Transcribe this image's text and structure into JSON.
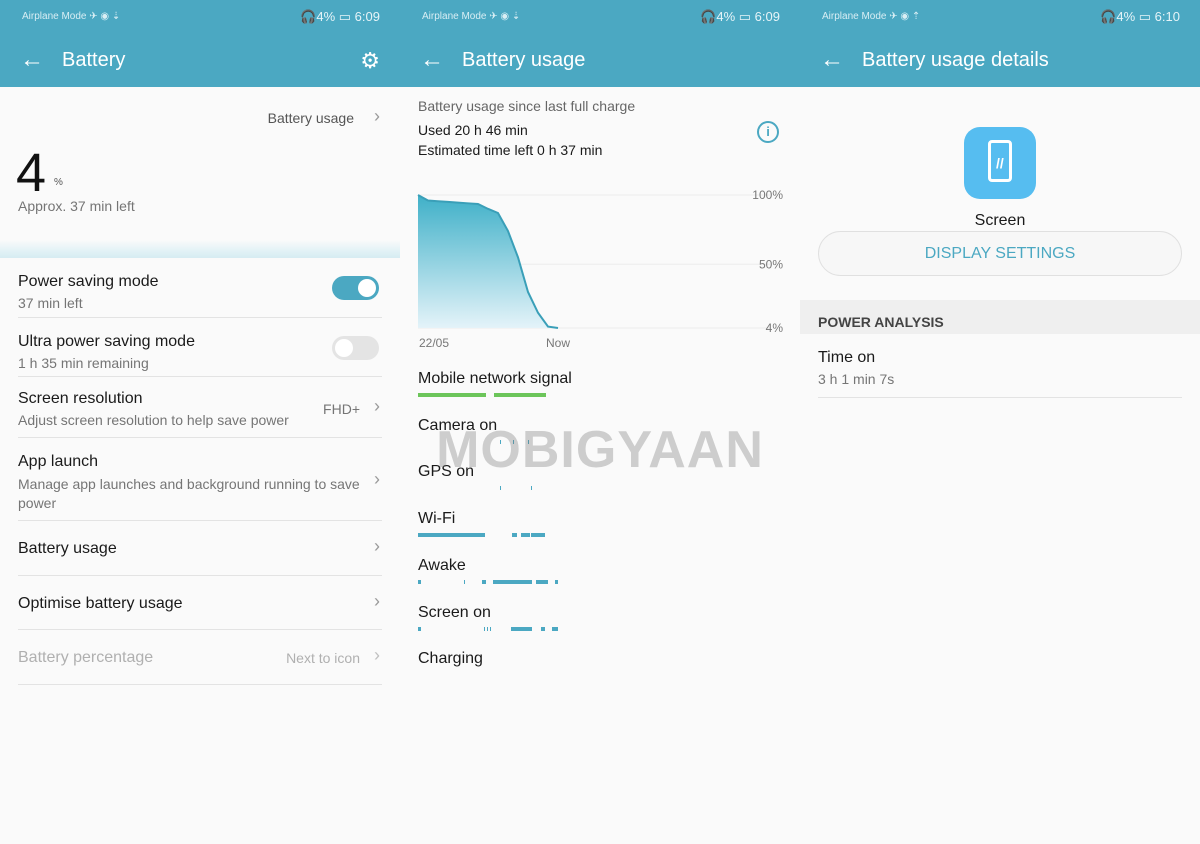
{
  "colors": {
    "header": "#4ba8c2",
    "accent": "#4ba8c2",
    "signal": "#6cc55a",
    "app_icon": "#56bdf0"
  },
  "watermark": "MOBIGYAAN",
  "status_bars": [
    {
      "left": "Airplane Mode ✈ ◉ ⇣",
      "right": "🎧4% ▭ 6:09"
    },
    {
      "left": "Airplane Mode ✈ ◉ ⇣",
      "right": "🎧4% ▭ 6:09"
    },
    {
      "left": "Airplane Mode ✈ ◉ ⇡",
      "right": "🎧4% ▭ 6:10"
    }
  ],
  "battery": {
    "title": "Battery",
    "usage_link": "Battery usage",
    "level": "4",
    "unit": "%",
    "approx": "Approx. 37 min left",
    "items": [
      {
        "title": "Power saving mode",
        "sub": "37 min left",
        "toggle": true
      },
      {
        "title": "Ultra power saving mode",
        "sub": "1 h 35 min remaining",
        "toggle": false
      },
      {
        "title": "Screen resolution",
        "sub": "Adjust screen resolution to help save power",
        "value": "FHD+"
      },
      {
        "title": "App launch",
        "sub": "Manage app launches and background running to save power"
      },
      {
        "title": "Battery usage"
      },
      {
        "title": "Optimise battery usage"
      },
      {
        "title": "Battery percentage",
        "value": "Next to icon",
        "disabled": true
      }
    ]
  },
  "usage": {
    "title": "Battery usage",
    "since": "Battery usage since last full charge",
    "used": "Used 20 h 46 min",
    "estimated": "Estimated time left 0 h 37 min",
    "timelines": [
      {
        "label": "Mobile network signal",
        "color": "#6cc55a",
        "segments": [
          [
            0,
            48.6
          ],
          [
            54.3,
            91.4
          ]
        ]
      },
      {
        "label": "Camera on",
        "color": "#4ba8c2",
        "segments": [
          [
            58.6,
            59.3
          ],
          [
            67.9,
            68.6
          ],
          [
            78.6,
            79.3
          ]
        ]
      },
      {
        "label": "GPS on",
        "color": "#4ba8c2",
        "segments": [
          [
            58.6,
            59.3
          ],
          [
            80.7,
            81.4
          ]
        ]
      },
      {
        "label": "Wi-Fi",
        "color": "#4ba8c2",
        "segments": [
          [
            0,
            47.9
          ],
          [
            67,
            70.7
          ],
          [
            73.6,
            80
          ],
          [
            81,
            91
          ]
        ]
      },
      {
        "label": "Awake",
        "color": "#4ba8c2",
        "segments": [
          [
            0,
            2
          ],
          [
            32.9,
            33.6
          ],
          [
            45.7,
            48.6
          ],
          [
            53.6,
            81.4
          ],
          [
            84,
            93
          ],
          [
            98,
            100
          ]
        ]
      },
      {
        "label": "Screen on",
        "color": "#4ba8c2",
        "segments": [
          [
            0,
            2
          ],
          [
            47,
            47.7
          ],
          [
            49.5,
            50.2
          ],
          [
            51.5,
            52.2
          ],
          [
            66.4,
            81.4
          ],
          [
            88,
            91
          ],
          [
            96,
            100
          ]
        ]
      },
      {
        "label": "Charging",
        "color": "#4ba8c2",
        "segments": []
      }
    ]
  },
  "chart_data": {
    "type": "area",
    "ylabel": "",
    "xlabel": "",
    "x_ticks": [
      "22/05",
      "Now"
    ],
    "y_ticks": [
      "100%",
      "50%",
      "4%"
    ],
    "ylim": [
      4,
      100
    ],
    "grid": true,
    "values": [
      100,
      96,
      95.5,
      95,
      94.5,
      94,
      93.5,
      90,
      87,
      74,
      55,
      30,
      15,
      5,
      4
    ]
  },
  "details": {
    "title": "Battery usage details",
    "app_icon": "phone-screen-icon",
    "app_name": "Screen",
    "button": "DISPLAY SETTINGS",
    "section": "POWER ANALYSIS",
    "row_title": "Time on",
    "row_value": "3 h 1 min 7s"
  }
}
